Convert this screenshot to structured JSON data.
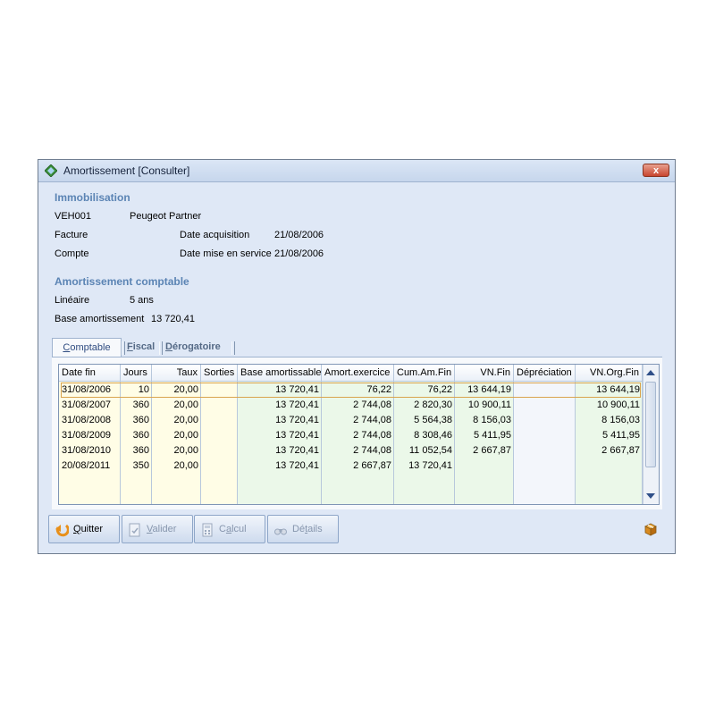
{
  "window": {
    "title": "Amortissement [Consulter]",
    "close_label": "x"
  },
  "immobilisation": {
    "section_title": "Immobilisation",
    "code": "VEH001",
    "name": "Peugeot Partner",
    "facture_label": "Facture",
    "compte_label": "Compte",
    "date_acq_label": "Date acquisition",
    "date_acq_value": "21/08/2006",
    "date_mes_label": "Date mise en service",
    "date_mes_value": "21/08/2006"
  },
  "amortissement": {
    "section_title": "Amortissement comptable",
    "mode_label": "Linéaire",
    "duree_value": "5 ans",
    "base_label": "Base amortissement",
    "base_value": "13 720,41"
  },
  "tabs": [
    {
      "label": "Comptable",
      "accel": "C",
      "rest": "omptable"
    },
    {
      "label": "Fiscal",
      "accel": "F",
      "rest": "iscal"
    },
    {
      "label": "Dérogatoire",
      "accel": "D",
      "rest": "érogatoire"
    }
  ],
  "table": {
    "columns": [
      "Date fin",
      "Jours",
      "Taux",
      "Sorties",
      "Base amortissable",
      "Amort.exercice",
      "Cum.Am.Fin",
      "VN.Fin",
      "Dépréciation",
      "VN.Org.Fin"
    ],
    "rows": [
      [
        "31/08/2006",
        "10",
        "20,00",
        "",
        "13 720,41",
        "76,22",
        "76,22",
        "13 644,19",
        "",
        "13 644,19"
      ],
      [
        "31/08/2007",
        "360",
        "20,00",
        "",
        "13 720,41",
        "2 744,08",
        "2 820,30",
        "10 900,11",
        "",
        "10 900,11"
      ],
      [
        "31/08/2008",
        "360",
        "20,00",
        "",
        "13 720,41",
        "2 744,08",
        "5 564,38",
        "8 156,03",
        "",
        "8 156,03"
      ],
      [
        "31/08/2009",
        "360",
        "20,00",
        "",
        "13 720,41",
        "2 744,08",
        "8 308,46",
        "5 411,95",
        "",
        "5 411,95"
      ],
      [
        "31/08/2010",
        "360",
        "20,00",
        "",
        "13 720,41",
        "2 744,08",
        "11 052,54",
        "2 667,87",
        "",
        "2 667,87"
      ],
      [
        "20/08/2011",
        "350",
        "20,00",
        "",
        "13 720,41",
        "2 667,87",
        "13 720,41",
        "",
        "",
        ""
      ]
    ]
  },
  "buttons": {
    "quitter": {
      "accel": "Q",
      "rest": "uitter"
    },
    "valider": {
      "accel": "V",
      "rest": "alider"
    },
    "calcul": {
      "first": "C",
      "accel": "a",
      "rest": "lcul"
    },
    "details": {
      "first": "Dé",
      "accel": "t",
      "rest": "ails"
    }
  },
  "colors": {
    "section": "#5b84b4",
    "accent_orange": "#e8901a",
    "selection_border": "#d9a44e"
  }
}
